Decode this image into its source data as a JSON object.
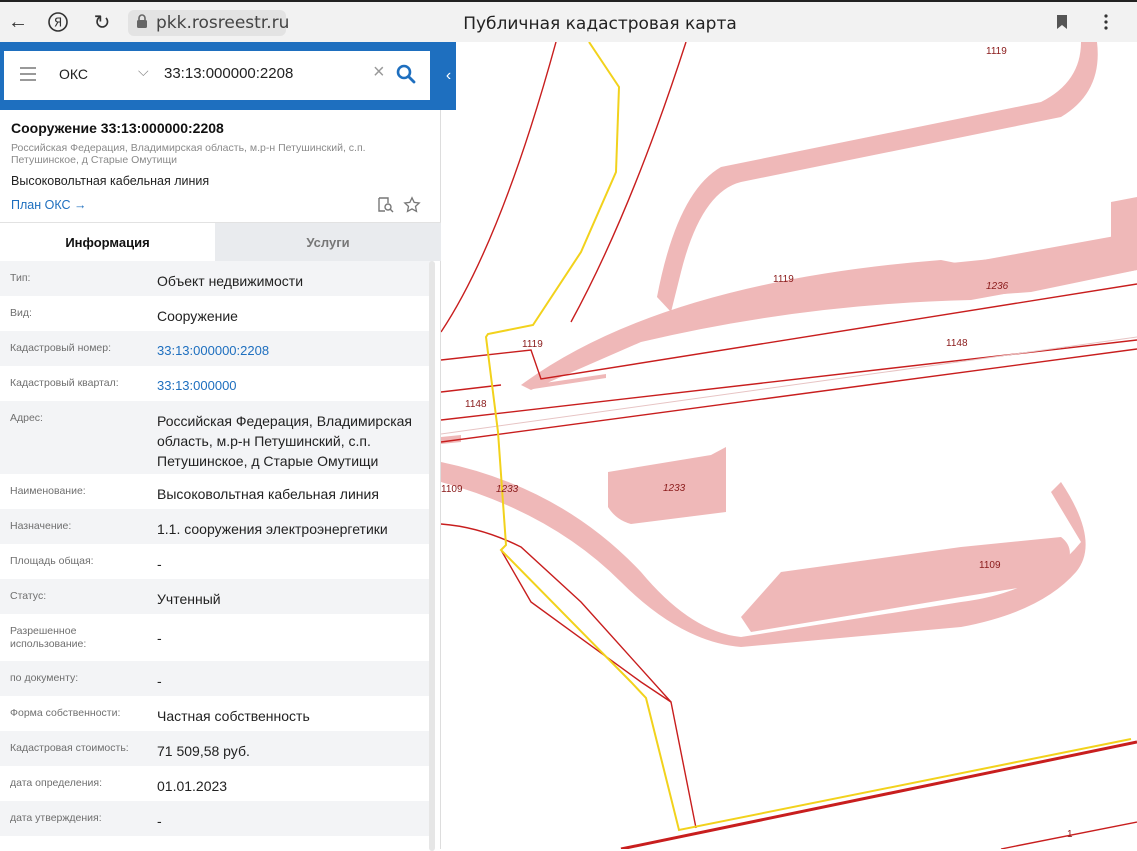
{
  "browser": {
    "url": "pkk.rosreestr.ru",
    "title": "Публичная кадастровая карта",
    "icons": [
      "back-icon",
      "yandex-icon",
      "reload-icon",
      "lock-icon",
      "bookmark-icon",
      "menu-dots-icon"
    ]
  },
  "search": {
    "type": "ОКС",
    "query": "33:13:000000:2208"
  },
  "object": {
    "title": "Сооружение 33:13:000000:2208",
    "address": "Российская Федерация, Владимирская область, м.р-н Петушинский, с.п. Петушинское, д Старые Омутищи",
    "name": "Высоковольтная кабельная линия",
    "plan_link": "План ОКС →"
  },
  "tabs": {
    "info": "Информация",
    "services": "Услуги"
  },
  "info_rows": [
    {
      "label": "Тип:",
      "value": "Объект недвижимости"
    },
    {
      "label": "Вид:",
      "value": "Сооружение"
    },
    {
      "label": "Кадастровый номер:",
      "value": "33:13:000000:2208"
    },
    {
      "label": "Кадастровый квартал:",
      "value": "33:13:000000"
    },
    {
      "label": "Адрес:",
      "value": "Российская Федерация, Владимирская область, м.р-н Петушинский, с.п. Петушинское, д Старые Омутищи"
    },
    {
      "label": "Наименование:",
      "value": "Высоковольтная кабельная линия"
    },
    {
      "label": "Назначение:",
      "value": "1.1. сооружения электроэнергетики"
    },
    {
      "label": "Площадь общая:",
      "value": "-"
    },
    {
      "label": "Статус:",
      "value": "Учтенный"
    },
    {
      "label": "Разрешенное использование:",
      "value": "-"
    },
    {
      "label": "по документу:",
      "value": "-"
    },
    {
      "label": "Форма собственности:",
      "value": "Частная собственность"
    },
    {
      "label": "Кадастровая стоимость:",
      "value": "71 509,58 руб."
    },
    {
      "label": "дата определения:",
      "value": "01.01.2023"
    },
    {
      "label": "дата утверждения:",
      "value": "-"
    }
  ],
  "map_labels": {
    "l1": "1119",
    "l2": "1119",
    "l3": "1119",
    "l4": "1236",
    "l5": "1148",
    "l6": "1148",
    "l7": "1109",
    "l8": "1233",
    "l9": "1233",
    "l10": "1109",
    "l11": "1"
  },
  "colors": {
    "accent": "#1e6fbf",
    "parcel_fill": "#efb8b8",
    "boundary_red": "#c81e1e",
    "selected_yellow": "#f2d21c"
  }
}
